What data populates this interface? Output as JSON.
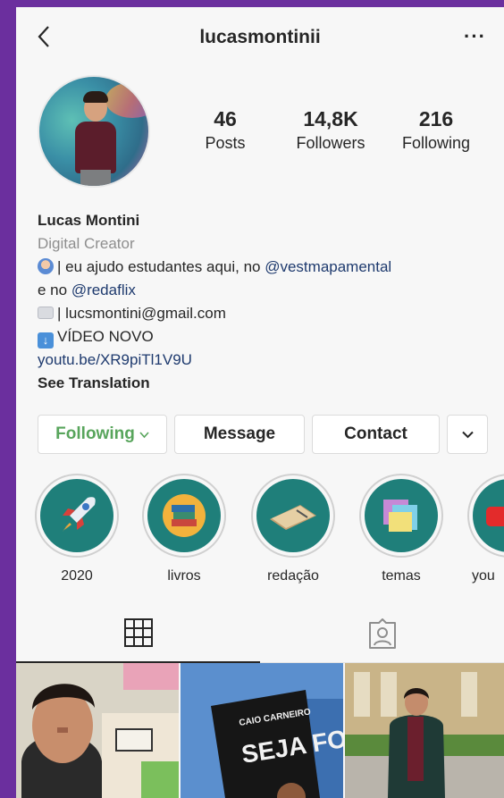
{
  "header": {
    "username": "lucasmontinii",
    "more_label": "···"
  },
  "stats": [
    {
      "value": "46",
      "label": "Posts"
    },
    {
      "value": "14,8K",
      "label": "Followers"
    },
    {
      "value": "216",
      "label": "Following"
    }
  ],
  "bio": {
    "name": "Lucas Montini",
    "category": "Digital Creator",
    "line1_text": "| eu ajudo estudantes aqui, no ",
    "line1_mention": "@vestmapamental",
    "line2_text": "e no ",
    "line2_mention": "@redaflix",
    "email_text": "| lucsmontini@gmail.com",
    "video_text": "VÍDEO NOVO",
    "link": "youtu.be/XR9piTl1V9U",
    "see_translation": "See Translation"
  },
  "buttons": {
    "following": "Following",
    "message": "Message",
    "contact": "Contact"
  },
  "highlights": [
    {
      "label": "2020"
    },
    {
      "label": "livros"
    },
    {
      "label": "redação"
    },
    {
      "label": "temas"
    },
    {
      "label": "you"
    }
  ],
  "colors": {
    "following_green": "#58a55c",
    "highlight_teal": "#1f7f7a",
    "link_blue": "#1e3a6e",
    "frame_purple": "#6b2f9e"
  },
  "icons": {
    "back": "chevron-left-icon",
    "more": "more-dots-icon",
    "grid": "grid-icon",
    "tagged": "tagged-person-icon",
    "dropdown": "chevron-down-icon"
  },
  "posts": [
    {
      "book_title": ""
    },
    {
      "book_author": "CAIO CARNEIRO",
      "book_title": "SEJA FODA!"
    },
    {
      "book_title": ""
    }
  ]
}
